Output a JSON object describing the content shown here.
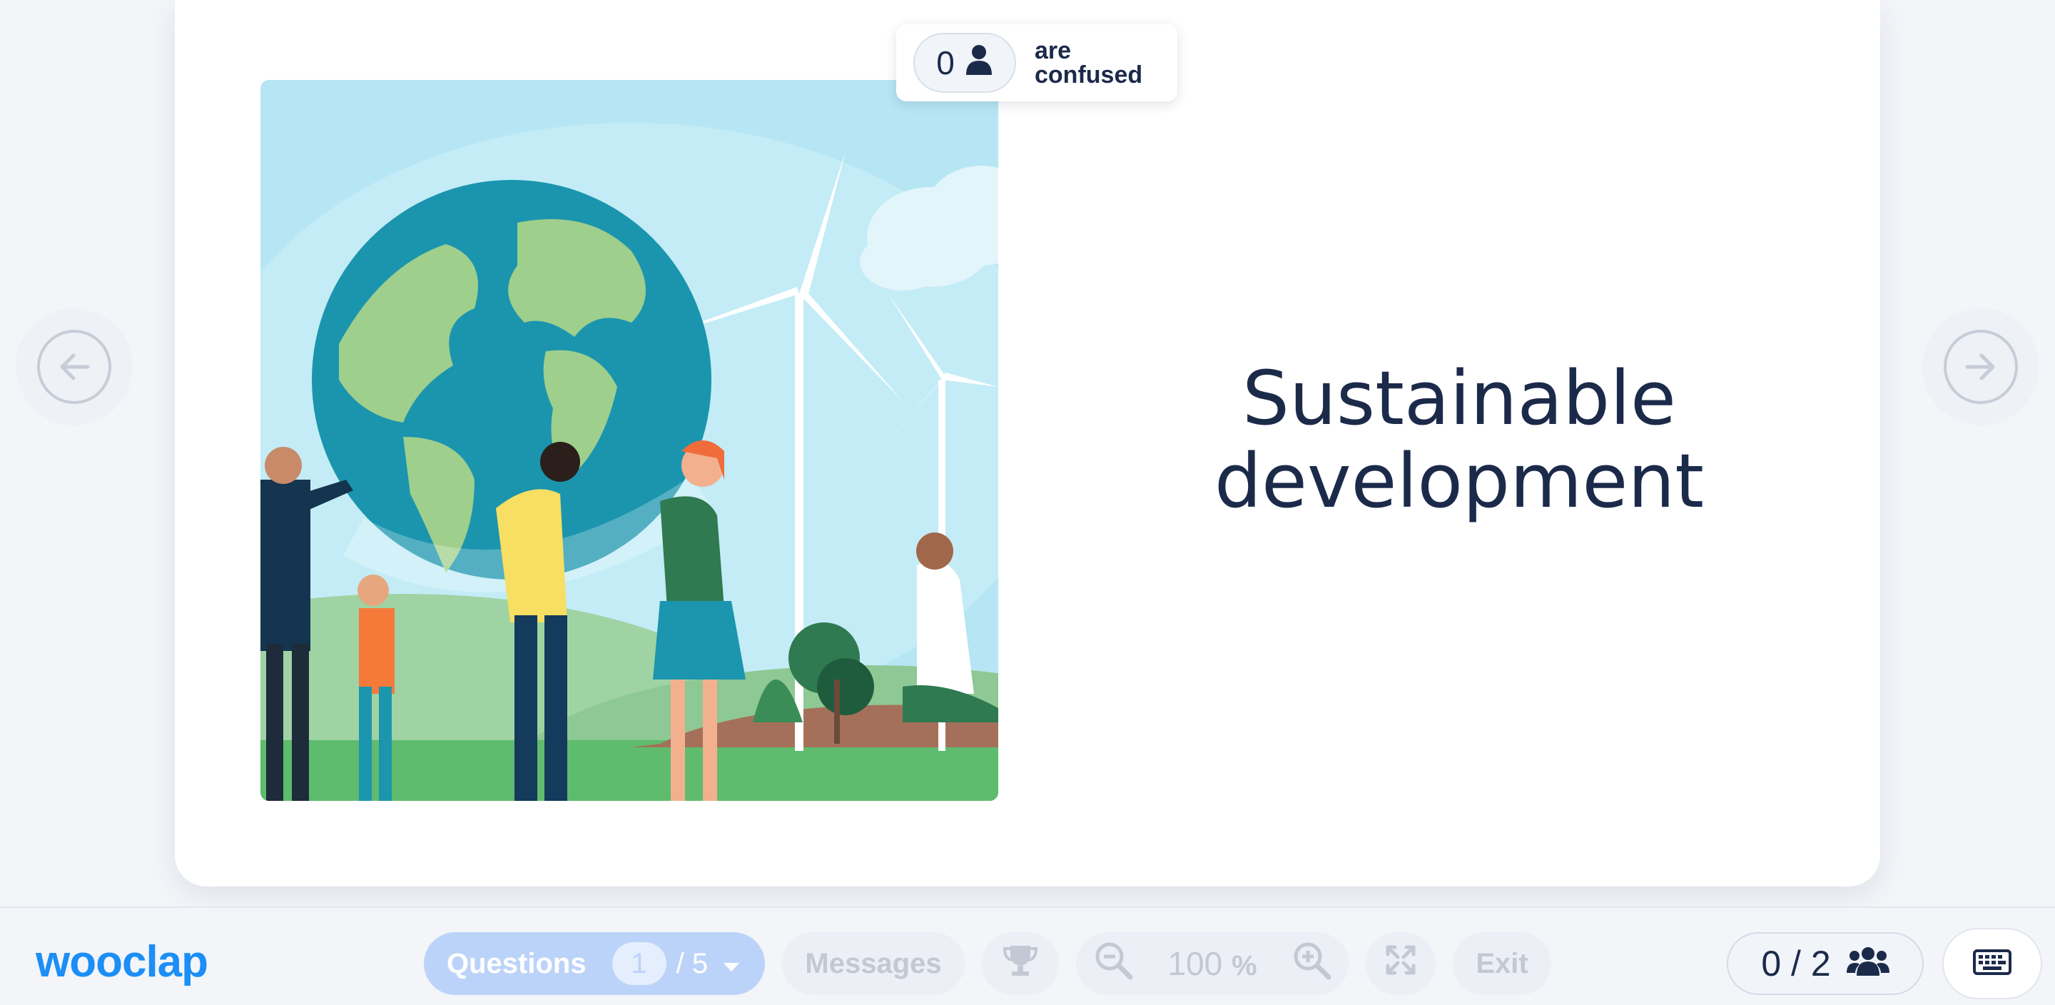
{
  "slide": {
    "title_line1": "Sustainable",
    "title_line2": "development",
    "illustration_icon": "sustainable-development-illustration"
  },
  "confused": {
    "count": "0",
    "label_line1": "are",
    "label_line2": "confused",
    "icon": "person-icon"
  },
  "navigation": {
    "prev_icon": "arrow-left-icon",
    "next_icon": "arrow-right-icon"
  },
  "toolbar": {
    "logo": "wooclap",
    "questions_label": "Questions",
    "question_current": "1",
    "question_total": "/ 5",
    "messages_label": "Messages",
    "trophy_icon": "trophy-icon",
    "zoom_value": "100",
    "zoom_unit": "%",
    "exit_label": "Exit",
    "participants_count": "0 / 2",
    "participants_icon": "users-icon",
    "keyboard_icon": "keyboard-icon"
  },
  "colors": {
    "brand": "#1c8ef5",
    "text_dark": "#1c2a4a",
    "questions_active": "#bcd3f9"
  }
}
